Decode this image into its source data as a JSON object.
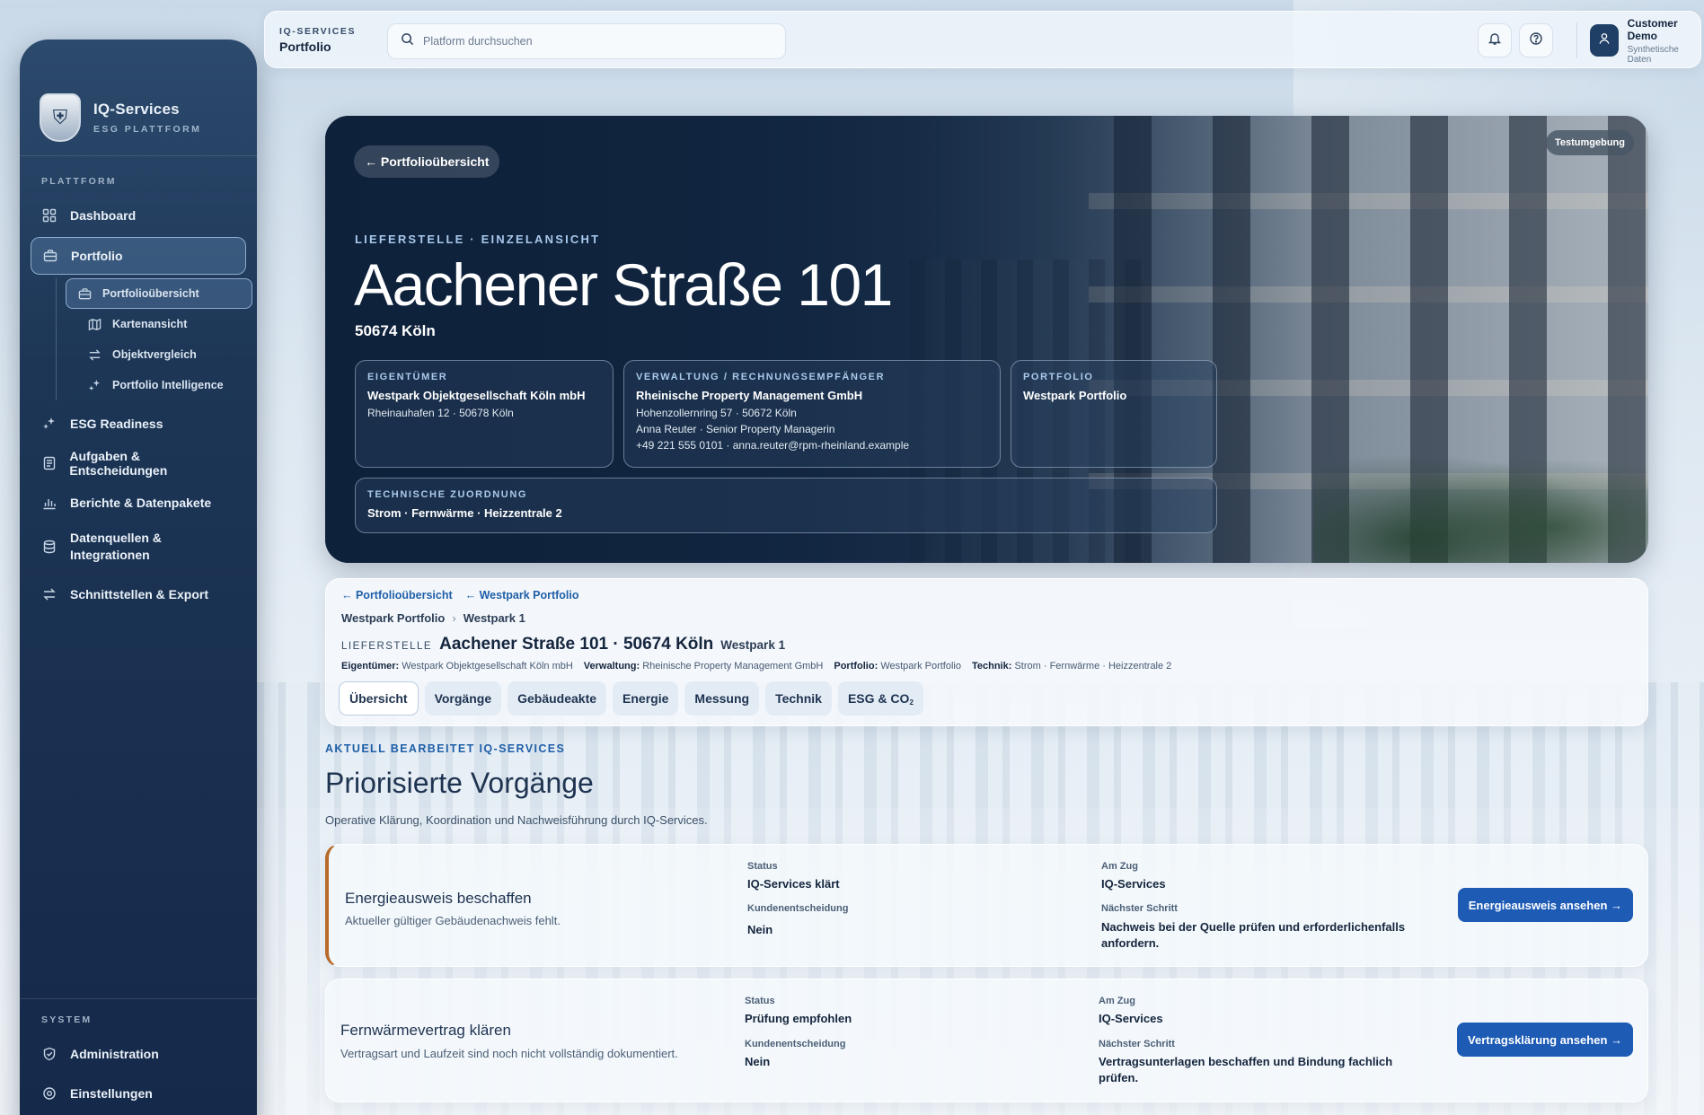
{
  "sidebar": {
    "brand_title": "IQ-Services",
    "brand_sub": "ESG PLATTFORM",
    "section_platform": "PLATTFORM",
    "section_system": "SYSTEM",
    "items": [
      {
        "label": "Dashboard",
        "icon": "grid-icon"
      },
      {
        "label": "Portfolio",
        "icon": "briefcase-icon"
      },
      {
        "label": "ESG Readiness",
        "icon": "sparkle-icon"
      },
      {
        "label": "Aufgaben & Entscheidungen",
        "icon": "clipboard-icon"
      },
      {
        "label": "Berichte & Datenpakete",
        "icon": "bar-chart-icon"
      },
      {
        "label": "Datenquellen & Integrationen",
        "icon": "database-icon"
      },
      {
        "label": "Schnittstellen & Export",
        "icon": "arrows-icon"
      }
    ],
    "sub_items": [
      {
        "label": "Portfolioübersicht",
        "icon": "briefcase-icon"
      },
      {
        "label": "Kartenansicht",
        "icon": "map-icon"
      },
      {
        "label": "Objektvergleich",
        "icon": "arrows-icon"
      },
      {
        "label": "Portfolio Intelligence",
        "icon": "sparkle-icon"
      }
    ],
    "system_items": [
      {
        "label": "Administration",
        "icon": "shield-icon"
      },
      {
        "label": "Einstellungen",
        "icon": "gear-icon"
      }
    ]
  },
  "topbar": {
    "crumb_top": "IQ-SERVICES",
    "crumb_page": "Portfolio",
    "search_placeholder": "Platform durchsuchen",
    "user_name": "Customer Demo",
    "user_role": "Synthetische Daten"
  },
  "hero": {
    "back_label": "← Portfolioübersicht",
    "env_badge": "Testumgebung",
    "kicker": "LIEFERSTELLE · EINZELANSICHT",
    "title": "Aachener Straße 101",
    "city": "50674 Köln",
    "owner": {
      "label": "EIGENTÜMER",
      "name": "Westpark Objektgesellschaft Köln mbH",
      "address": "Rheinauhafen 12 · 50678 Köln"
    },
    "management": {
      "label": "VERWALTUNG / RECHNUNGSEMPFÄNGER",
      "name": "Rheinische Property Management GmbH",
      "address": "Hohenzollernring 57 · 50672 Köln",
      "contact": "Anna Reuter · Senior Property Managerin",
      "phone": "+49 221 555 0101 · anna.reuter@rpm-rheinland.example"
    },
    "portfolio": {
      "label": "PORTFOLIO",
      "name": "Westpark Portfolio"
    },
    "technical": {
      "label": "TECHNISCHE ZUORDNUNG",
      "value": "Strom · Fernwärme · Heizzentrale 2"
    }
  },
  "panel": {
    "link_overview": "← Portfolioübersicht",
    "link_portfolio": "← Westpark Portfolio",
    "breadcrumb": [
      "Westpark Portfolio",
      "›",
      "Westpark 1"
    ],
    "kind": "LIEFERSTELLE",
    "title": "Aachener Straße 101 · 50674 Köln",
    "subtitle": "Westpark 1",
    "meta": [
      {
        "k": "Eigentümer:",
        "v": "Westpark Objektgesellschaft Köln mbH"
      },
      {
        "k": "Verwaltung:",
        "v": "Rheinische Property Management GmbH"
      },
      {
        "k": "Portfolio:",
        "v": "Westpark Portfolio"
      },
      {
        "k": "Technik:",
        "v": "Strom · Fernwärme · Heizzentrale 2"
      }
    ],
    "tabs": [
      "Übersicht",
      "Vorgänge",
      "Gebäudeakte",
      "Energie",
      "Messung",
      "Technik",
      "ESG & CO",
      "2"
    ]
  },
  "processes": {
    "kicker": "AKTUELL BEARBEITET IQ-SERVICES",
    "title": "Priorisierte Vorgänge",
    "desc": "Operative Klärung, Koordination und Nachweisführung durch IQ-Services.",
    "labels": {
      "status": "Status",
      "decision": "Kundenentscheidung",
      "turn": "Am Zug",
      "next": "Nächster Schritt"
    },
    "items": [
      {
        "title": "Energieausweis beschaffen",
        "desc": "Aktueller gültiger Gebäudenachweis fehlt.",
        "status": "IQ-Services klärt",
        "decision": "Nein",
        "turn": "IQ-Services",
        "next": "Nachweis bei der Quelle prüfen und erforderlichenfalls anfordern.",
        "cta": "Energieausweis ansehen →"
      },
      {
        "title": "Fernwärmevertrag klären",
        "desc": "Vertragsart und Laufzeit sind noch nicht vollständig dokumentiert.",
        "status": "Prüfung empfohlen",
        "decision": "Nein",
        "turn": "IQ-Services",
        "next": "Vertragsunterlagen beschaffen und Bindung fachlich prüfen.",
        "cta": "Vertragsklärung ansehen →"
      }
    ]
  }
}
